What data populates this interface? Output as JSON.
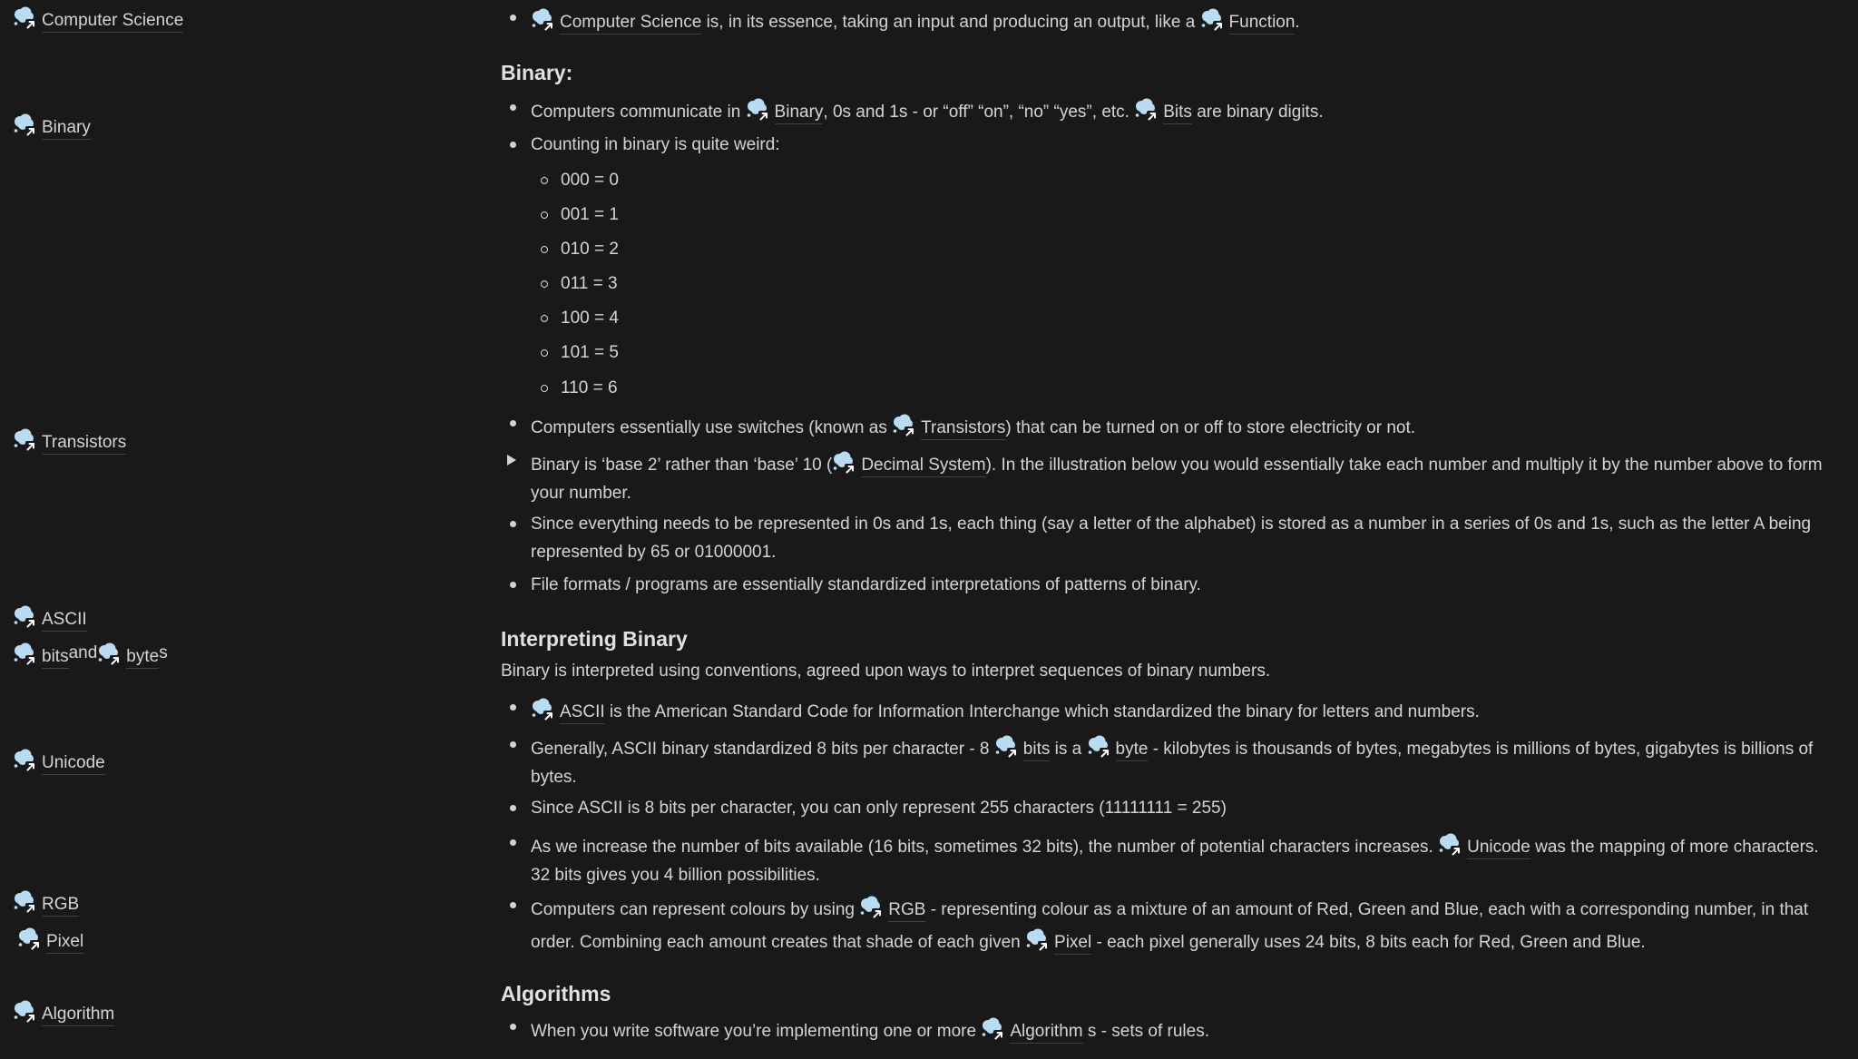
{
  "colors": {
    "background": "#191919",
    "text": "#cfcfcf",
    "icon_bubble": "#b9dcf5"
  },
  "sidebar": {
    "links": [
      {
        "parts": [
          {
            "type": "mention",
            "text": "Computer Science"
          }
        ]
      },
      {
        "parts": [
          {
            "type": "mention",
            "text": "Binary"
          }
        ]
      },
      {
        "parts": [
          {
            "type": "mention",
            "text": "Transistors"
          }
        ]
      },
      {
        "parts": [
          {
            "type": "mention",
            "text": "ASCII"
          }
        ]
      },
      {
        "parts": [
          {
            "type": "mention",
            "text": "bits"
          },
          {
            "type": "text",
            "text": " and "
          },
          {
            "type": "mention",
            "text": "byte"
          },
          {
            "type": "text",
            "text": " s"
          }
        ]
      },
      {
        "parts": [
          {
            "type": "mention",
            "text": "Unicode"
          }
        ]
      },
      {
        "parts": [
          {
            "type": "mention",
            "text": "RGB"
          }
        ]
      },
      {
        "parts": [
          {
            "type": "mention",
            "text": "Pixel"
          }
        ]
      },
      {
        "parts": [
          {
            "type": "mention",
            "text": "Algorithm"
          }
        ]
      }
    ]
  },
  "main": {
    "intro_bullet": [
      {
        "type": "mention",
        "text": "Computer Science"
      },
      {
        "type": "text",
        "text": " is, in its essence, taking an input and producing an output, like a "
      },
      {
        "type": "mention",
        "text": "Function"
      },
      {
        "type": "text",
        "text": "."
      }
    ],
    "binary_heading": "Binary:",
    "binary_bullets": [
      [
        {
          "type": "text",
          "text": "Computers communicate in "
        },
        {
          "type": "mention",
          "text": "Binary"
        },
        {
          "type": "text",
          "text": ", 0s and 1s - or “off” “on”, “no” “yes”, etc. "
        },
        {
          "type": "mention",
          "text": "Bits"
        },
        {
          "type": "text",
          "text": " are binary digits."
        }
      ],
      [
        {
          "type": "text",
          "text": "Counting in binary is quite weird:"
        }
      ]
    ],
    "counting": [
      "000 = 0",
      "001 = 1",
      "010 = 2",
      "011 = 3",
      "100 = 4",
      "101 = 5",
      "110 = 6"
    ],
    "transistors_bullet": [
      {
        "type": "text",
        "text": "Computers essentially use switches (known as "
      },
      {
        "type": "mention",
        "text": "Transistors"
      },
      {
        "type": "text",
        "text": ") that can be turned on or off to store electricity or not."
      }
    ],
    "toggle_bullet": [
      {
        "type": "text",
        "text": "Binary is ‘base 2’ rather than ‘base’ 10 ("
      },
      {
        "type": "mention",
        "text": "Decimal System"
      },
      {
        "type": "text",
        "text": "). In the illustration below you would essentially take each number and multiply it by the number above to form your number."
      }
    ],
    "binary_more_bullets": [
      [
        {
          "type": "text",
          "text": "Since everything needs to be represented in 0s and 1s, each thing (say a letter of the alphabet) is stored as a number in a series of 0s and 1s, such as the letter A being represented by 65 or 01000001."
        }
      ],
      [
        {
          "type": "text",
          "text": "File formats / programs are essentially standardized interpretations of patterns of binary."
        }
      ]
    ],
    "interpreting_heading": "Interpreting Binary",
    "interpreting_paragraph": "Binary is interpreted using conventions, agreed upon ways to interpret sequences of binary numbers.",
    "interpreting_bullets": [
      [
        {
          "type": "mention",
          "text": "ASCII "
        },
        {
          "type": "text",
          "text": " is the American Standard Code for Information Interchange which standardized the binary for letters and numbers."
        }
      ],
      [
        {
          "type": "text",
          "text": "Generally, ASCII binary standardized 8 bits per character - 8 "
        },
        {
          "type": "mention",
          "text": "bits "
        },
        {
          "type": "text",
          "text": " is a "
        },
        {
          "type": "mention",
          "text": "byte"
        },
        {
          "type": "text",
          "text": " - kilobytes is thousands of bytes, megabytes is millions of bytes, gigabytes is billions of bytes."
        }
      ],
      [
        {
          "type": "text",
          "text": "Since ASCII is 8 bits per character, you can only represent 255 characters (11111111 = 255)"
        }
      ],
      [
        {
          "type": "text",
          "text": "As we increase the number of bits available (16 bits, sometimes 32 bits), the number of potential characters increases. "
        },
        {
          "type": "mention",
          "text": "Unicode"
        },
        {
          "type": "text",
          "text": " was the mapping of more characters. 32 bits gives you 4 billion possibilities."
        }
      ],
      [
        {
          "type": "text",
          "text": "Computers can represent colours by using "
        },
        {
          "type": "mention",
          "text": "RGB "
        },
        {
          "type": "text",
          "text": " - representing colour as a mixture of an amount of Red, Green and Blue, each with a corresponding number, in that order. Combining each amount creates that shade of each given "
        },
        {
          "type": "mention",
          "text": "Pixel"
        },
        {
          "type": "text",
          "text": " - each pixel generally uses 24 bits, 8 bits each for Red, Green and Blue."
        }
      ]
    ],
    "algorithms_heading": "Algorithms",
    "algorithms_bullets": [
      [
        {
          "type": "text",
          "text": "When you write software you’re implementing one or more "
        },
        {
          "type": "mention",
          "text": "Algorithm"
        },
        {
          "type": "text",
          "text": " s - sets of rules."
        }
      ]
    ]
  }
}
